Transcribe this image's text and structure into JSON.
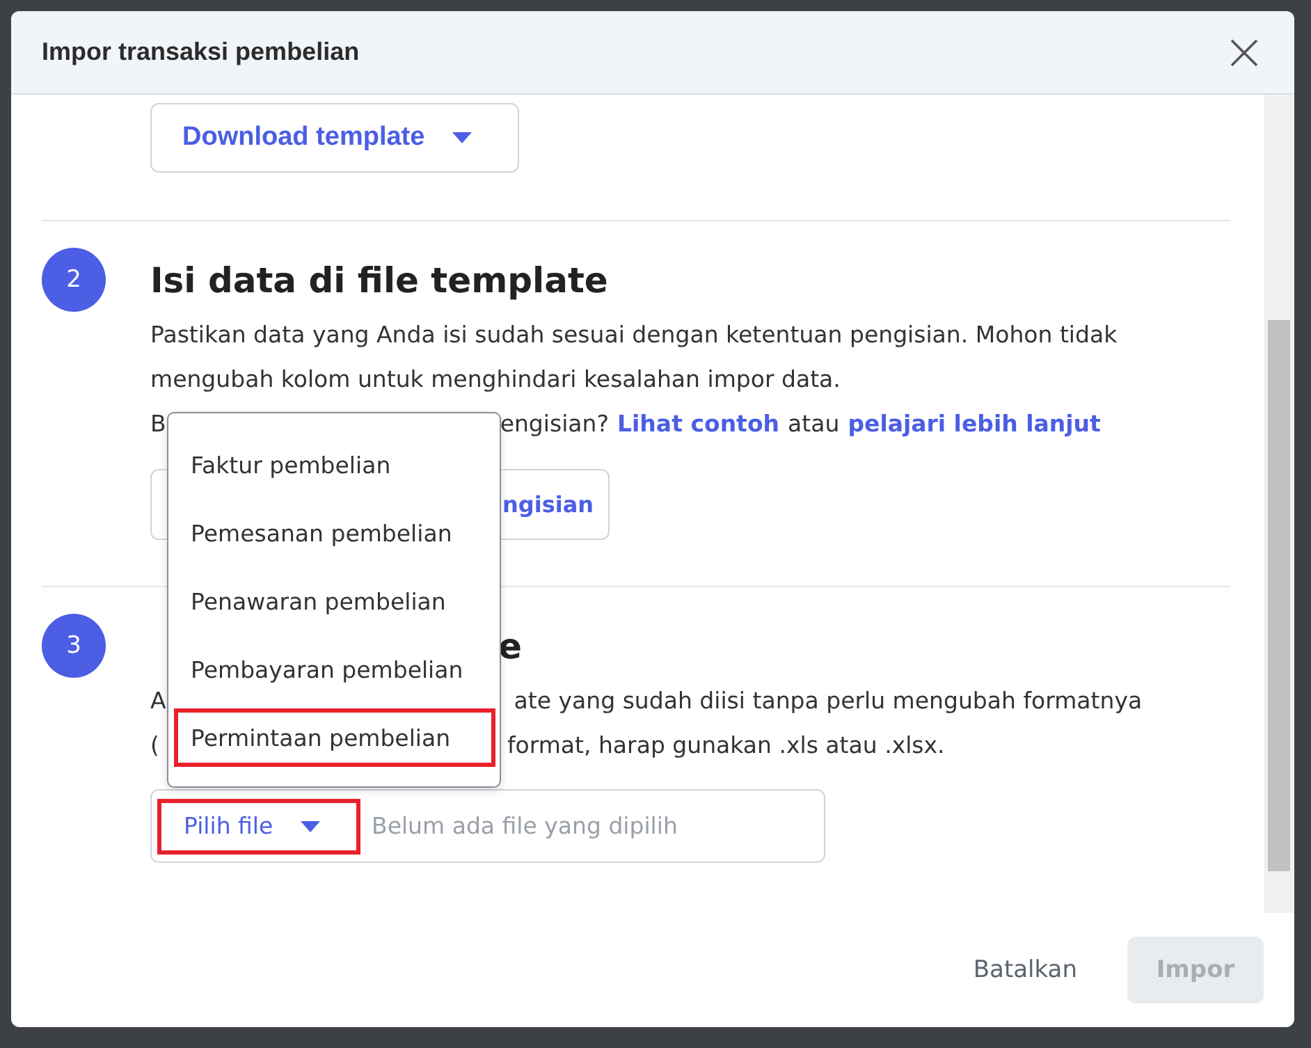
{
  "dialog": {
    "title": "Impor transaksi pembelian"
  },
  "download_button": {
    "label": "Download template"
  },
  "steps": [
    {
      "number": "2",
      "title": "Isi data di file template",
      "lines": [
        [
          "Pastikan data yang Anda isi sudah sesuai dengan ketentuan pengisian. Mohon tidak"
        ],
        [
          "mengubah kolom untuk menghindari kesalahan impor data."
        ]
      ],
      "help": {
        "visible_start": "B",
        "text": "engisian?",
        "link1": "Lihat contoh",
        "middle": "atau",
        "link2": "pelajari lebih lanjut"
      },
      "button": {
        "label": "ngisian"
      }
    },
    {
      "number": "3",
      "title_end": "e",
      "lines": [
        [
          "A",
          "ate yang sudah diisi tanpa perlu mengubah formatnya"
        ],
        [
          "(",
          "format, harap gunakan .xls atau .xlsx."
        ]
      ],
      "file": {
        "button": "Pilih file",
        "highlighted": true,
        "placeholder": "Belum ada file yang dipilih"
      }
    }
  ],
  "menu": {
    "items": [
      {
        "label": "Faktur pembelian",
        "highlighted": false
      },
      {
        "label": "Pemesanan pembelian",
        "highlighted": false
      },
      {
        "label": "Penawaran pembelian",
        "highlighted": false
      },
      {
        "label": "Pembayaran pembelian",
        "highlighted": false
      },
      {
        "label": "Permintaan pembelian",
        "highlighted": true
      }
    ]
  },
  "footer": {
    "cancel": "Batalkan",
    "submit": "Impor",
    "submit_disabled": true
  }
}
